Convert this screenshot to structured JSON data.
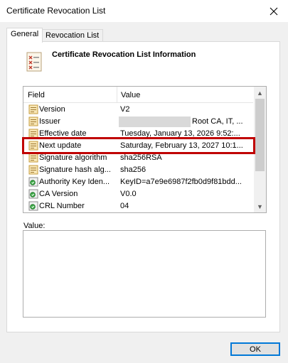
{
  "window": {
    "title": "Certificate Revocation List"
  },
  "tabs": [
    {
      "label": "General",
      "active": true
    },
    {
      "label": "Revocation List",
      "active": false
    }
  ],
  "header": {
    "title": "Certificate Revocation List Information"
  },
  "list": {
    "columns": [
      "Field",
      "Value"
    ],
    "rows": [
      {
        "field": "Version",
        "value": "V2",
        "icon": "certificate-field-icon"
      },
      {
        "field": "Issuer",
        "value": "Root CA, IT, ...",
        "icon": "certificate-field-icon",
        "redacted": true
      },
      {
        "field": "Effective date",
        "value": "Tuesday, January 13, 2026 9:52:...",
        "icon": "certificate-field-icon"
      },
      {
        "field": "Next update",
        "value": "Saturday, February 13, 2027 10:1...",
        "icon": "certificate-field-icon",
        "highlighted": true
      },
      {
        "field": "Signature algorithm",
        "value": "sha256RSA",
        "icon": "certificate-field-icon"
      },
      {
        "field": "Signature hash alg...",
        "value": "sha256",
        "icon": "certificate-field-icon"
      },
      {
        "field": "Authority Key Iden...",
        "value": "KeyID=a7e9e6987f2fb0d9f81bdd...",
        "icon": "extension-icon"
      },
      {
        "field": "CA Version",
        "value": "V0.0",
        "icon": "extension-icon"
      },
      {
        "field": "CRL Number",
        "value": "04",
        "icon": "extension-icon"
      }
    ]
  },
  "value_section": {
    "label": "Value:",
    "content": ""
  },
  "buttons": {
    "ok": "OK"
  },
  "colors": {
    "highlight": "#c00000",
    "accent": "#0078d7"
  }
}
